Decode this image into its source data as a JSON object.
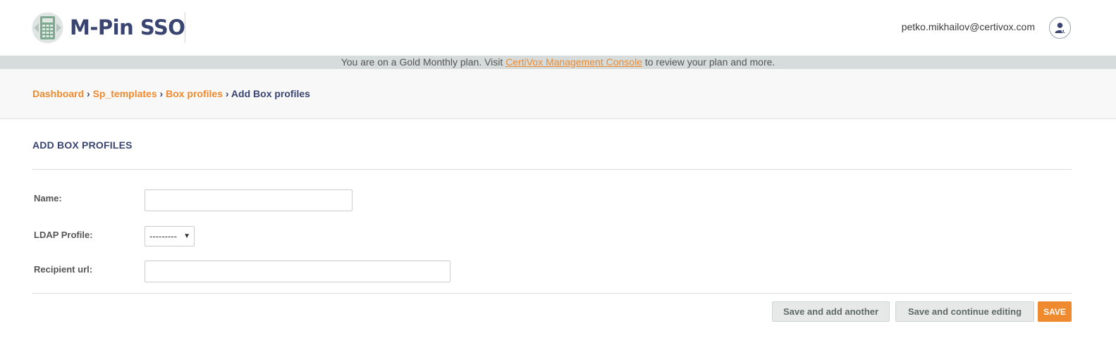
{
  "app": {
    "name": "M-Pin SSO",
    "user_email": "petko.mikhailov@certivox.com"
  },
  "plan_notice": {
    "prefix": "You are on a Gold Monthly plan. Visit ",
    "link_text": "CertiVox Management Console",
    "suffix": " to review your plan and more."
  },
  "breadcrumb": {
    "items": [
      "Dashboard",
      "Sp_templates",
      "Box profiles"
    ],
    "separator": "›",
    "current": "Add Box profiles"
  },
  "form": {
    "title": "ADD BOX PROFILES",
    "fields": {
      "name": {
        "label": "Name:",
        "value": ""
      },
      "ldap_profile": {
        "label": "LDAP Profile:",
        "selected": "---------"
      },
      "recipient_url": {
        "label": "Recipient url:",
        "value": ""
      }
    }
  },
  "actions": {
    "save_add_another": "Save and add another",
    "save_continue": "Save and continue editing",
    "save": "SAVE"
  },
  "colors": {
    "brand_navy": "#3a4470",
    "accent_orange": "#f08a2f",
    "plan_bar_bg": "#d5dcdb"
  },
  "icons": {
    "logo": "calculator-logo-icon",
    "user": "user-account-icon",
    "select_caret": "caret-down-icon"
  }
}
